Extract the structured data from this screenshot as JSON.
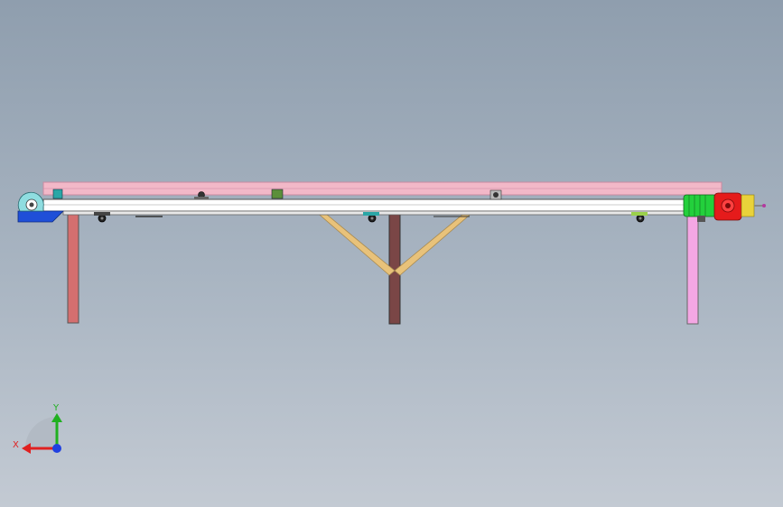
{
  "viewport": {
    "name": "cad-3d-viewport",
    "background_top": "#8f9eae",
    "background_bottom": "#c3cad3"
  },
  "model": {
    "name": "belt-conveyor-assembly",
    "colors": {
      "belt_top": "#f2b8c8",
      "belt_edge": "#c98aa0",
      "frame": "#ffffff",
      "frame_edge": "#555555",
      "leg_left": "#d46f6f",
      "leg_mid": "#7a4646",
      "leg_right": "#f4a7e4",
      "brace": "#e8c27a",
      "motor": "#23d03c",
      "gearbox": "#e51b1b",
      "tail_base": "#1f4fd8",
      "tail_pulley": "#8fdde0",
      "accent_teal": "#2aa6a6",
      "block_green": "#5b8f3a",
      "yellow_shaft": "#e9d23a"
    }
  },
  "triad": {
    "x_label": "X",
    "y_label": "Y",
    "x_color": "#e02020",
    "y_color": "#20b020",
    "z_color": "#2040e0"
  }
}
